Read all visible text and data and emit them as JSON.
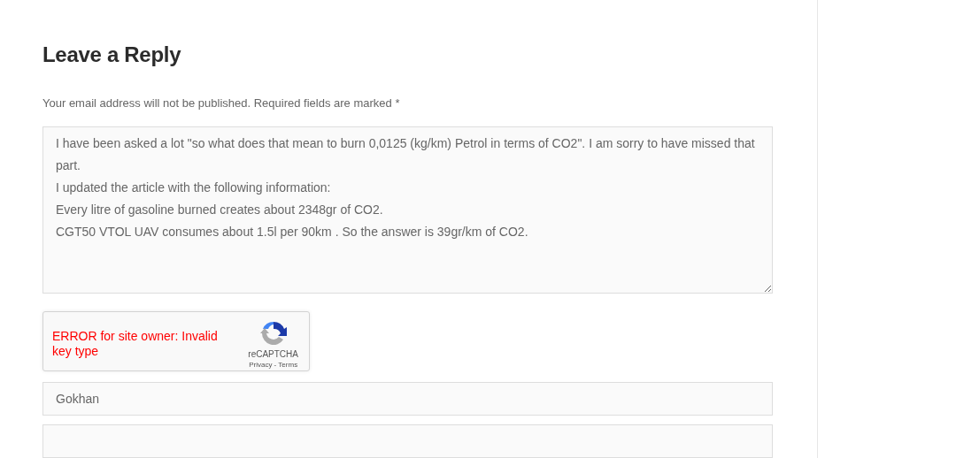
{
  "heading": "Leave a Reply",
  "notice": "Your email address will not be published. Required fields are marked *",
  "comment": {
    "value": "I have been asked a lot \"so what does that mean to burn 0,0125 (kg/km) Petrol in terms of CO2\". I am sorry to have missed that part.\nI updated the article with the following information:\nEvery litre of gasoline burned creates about 2348gr of CO2.\nCGT50 VTOL UAV consumes about 1.5l per 90km . So the answer is 39gr/km of CO2."
  },
  "recaptcha": {
    "error": "ERROR for site owner: Invalid key type",
    "brand": "reCAPTCHA",
    "links": "Privacy - Terms"
  },
  "fields": [
    {
      "kind": "text",
      "value": "Gokhan"
    },
    {
      "kind": "text"
    }
  ]
}
